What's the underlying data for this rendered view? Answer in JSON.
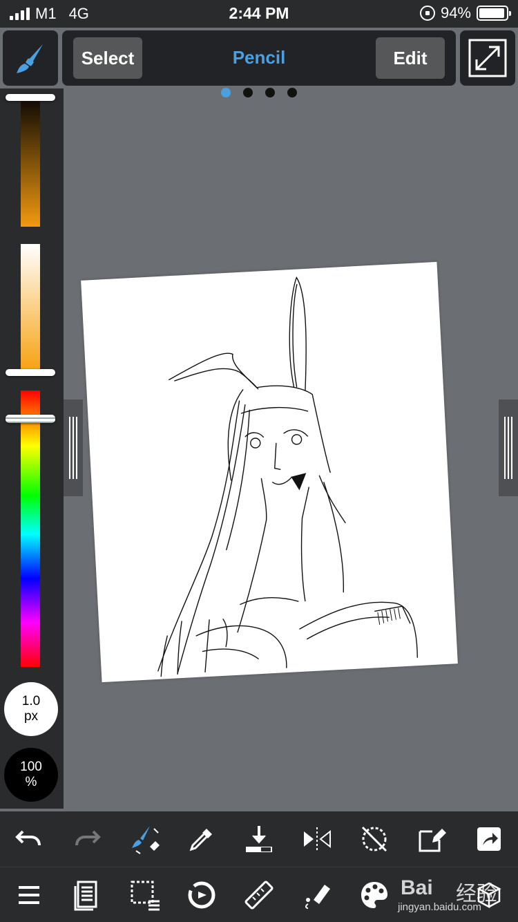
{
  "status_bar": {
    "carrier": "M1",
    "network": "4G",
    "time": "2:44 PM",
    "battery_percent": "94%",
    "battery_level": 0.94
  },
  "toolbar": {
    "select_label": "Select",
    "tool_name": "Pencil",
    "edit_label": "Edit",
    "page_dots": 4,
    "active_page": 0
  },
  "brush": {
    "size_value": "1.0",
    "size_unit": "px",
    "opacity_value": "100",
    "opacity_unit": "%"
  },
  "colors": {
    "accent": "#4aa0e0",
    "panel": "#222326",
    "background": "#6b6e73"
  },
  "bottom_toolbar_1": [
    "undo-icon",
    "redo-icon",
    "brush-swap-icon",
    "eyedropper-icon",
    "download-icon",
    "flip-horizontal-icon",
    "rotate-lock-icon",
    "transform-icon",
    "share-icon"
  ],
  "bottom_toolbar_2": [
    "menu-icon",
    "layers-list-icon",
    "selection-icon",
    "snap-icon",
    "ruler-icon",
    "fill-icon",
    "palette-icon",
    "material-icon"
  ],
  "watermark": {
    "brand": "Bai",
    "brand_cn": "经验",
    "url": "jingyan.baidu.com"
  }
}
